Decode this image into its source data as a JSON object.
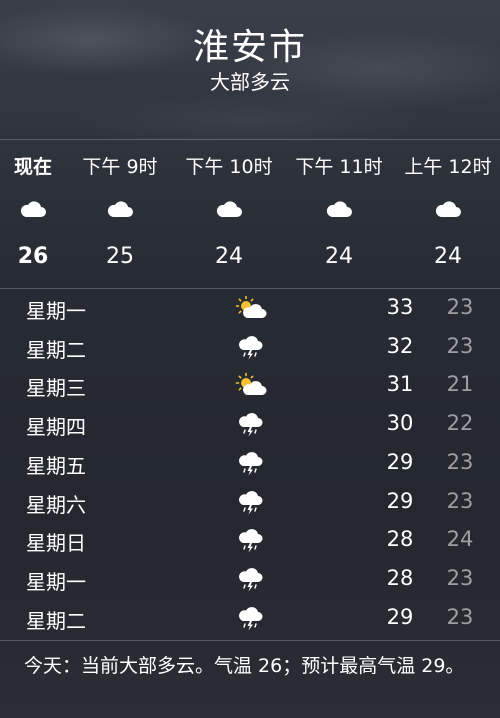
{
  "location": {
    "city": "淮安市",
    "condition": "大部多云"
  },
  "hourly": [
    {
      "time": "现在",
      "icon": "cloud-icon",
      "temp": "26"
    },
    {
      "time": "下午 9时",
      "icon": "cloud-icon",
      "temp": "25"
    },
    {
      "time": "下午 10时",
      "icon": "cloud-icon",
      "temp": "24"
    },
    {
      "time": "下午 11时",
      "icon": "cloud-icon",
      "temp": "24"
    },
    {
      "time": "上午 12时",
      "icon": "cloud-icon",
      "temp": "24"
    }
  ],
  "daily": [
    {
      "day": "星期一",
      "icon": "partly-sunny-icon",
      "high": "33",
      "low": "23"
    },
    {
      "day": "星期二",
      "icon": "thunderstorm-icon",
      "high": "32",
      "low": "23"
    },
    {
      "day": "星期三",
      "icon": "partly-sunny-icon",
      "high": "31",
      "low": "21"
    },
    {
      "day": "星期四",
      "icon": "thunderstorm-icon",
      "high": "30",
      "low": "22"
    },
    {
      "day": "星期五",
      "icon": "thunderstorm-icon",
      "high": "29",
      "low": "23"
    },
    {
      "day": "星期六",
      "icon": "thunderstorm-icon",
      "high": "29",
      "low": "23"
    },
    {
      "day": "星期日",
      "icon": "thunderstorm-icon",
      "high": "28",
      "low": "24"
    },
    {
      "day": "星期一",
      "icon": "thunderstorm-icon",
      "high": "28",
      "low": "23"
    },
    {
      "day": "星期二",
      "icon": "thunderstorm-icon",
      "high": "29",
      "low": "23"
    }
  ],
  "summary": "今天：当前大部多云。气温 26；预计最高气温 29。",
  "colors": {
    "sun": "#f6c234",
    "cloud": "#ffffff",
    "low_temp": "#9a9ca1",
    "divider": "#54575e"
  }
}
